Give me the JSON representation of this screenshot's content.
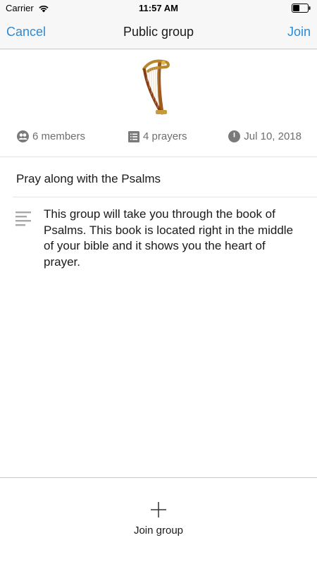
{
  "status_bar": {
    "carrier": "Carrier",
    "time": "11:57 AM"
  },
  "nav": {
    "cancel_label": "Cancel",
    "title": "Public group",
    "join_label": "Join"
  },
  "group": {
    "image_icon": "harp",
    "members": "6 members",
    "prayers": "4 prayers",
    "date": "Jul 10, 2018",
    "name": "Pray along with the Psalms",
    "description": "This group will take you through the book of Psalms. This book is located right in the middle of your bible and it shows you the heart of prayer."
  },
  "footer": {
    "join_group_label": "Join group"
  },
  "colors": {
    "accent": "#2a8bd6",
    "meta_text": "#6e6e6e",
    "bar_background": "#f7f7f7"
  }
}
